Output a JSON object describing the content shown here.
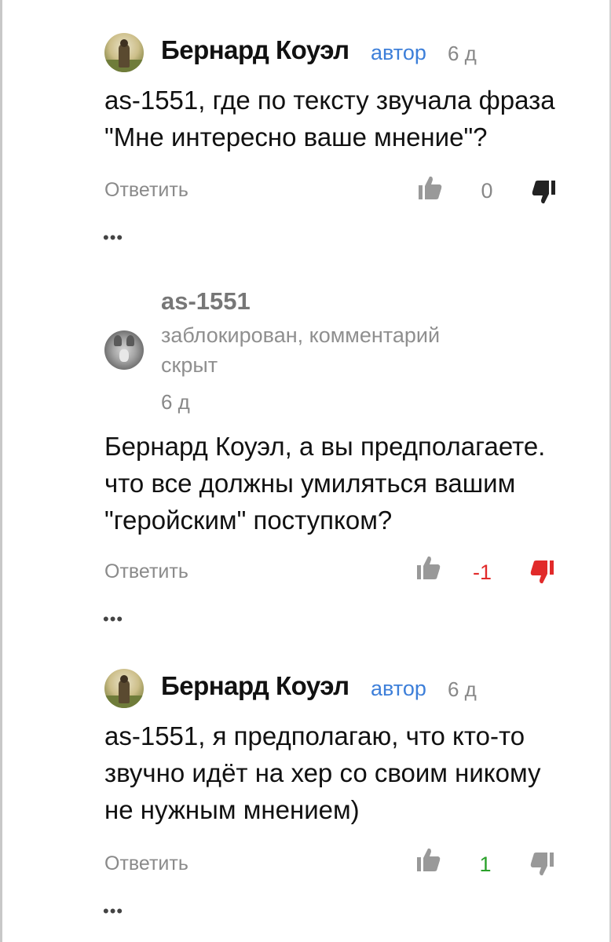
{
  "comments": [
    {
      "author": "Бернард Коуэл",
      "tag": "автор",
      "time": "6 д",
      "text_lines": [
        "as-1551, где по тексту звучала фраза",
        "\"Мне интересно ваше мнение\"?"
      ],
      "reply_label": "Ответить",
      "score": "0",
      "more": "•••"
    },
    {
      "author": "as-1551",
      "status_lines": [
        "заблокирован, комментарий",
        "скрыт"
      ],
      "time": "6 д",
      "text_lines": [
        "Бернард Коуэл, а вы предполагаете.",
        "что все должны умиляться вашим",
        "\"геройским\" поступком?"
      ],
      "reply_label": "Ответить",
      "score": "-1",
      "more": "•••"
    },
    {
      "author": "Бернард Коуэл",
      "tag": "автор",
      "time": "6 д",
      "text_lines": [
        "as-1551, я предполагаю, что кто-то",
        "звучно идёт на хер со своим никому",
        "не нужным мнением)"
      ],
      "reply_label": "Ответить",
      "score": "1",
      "more": "•••"
    }
  ],
  "icons": {
    "like": "thumbs-up-icon",
    "dislike": "thumbs-down-icon",
    "more": "more-dots-icon"
  },
  "colors": {
    "link": "#3d7fd9",
    "negative": "#e12a2a",
    "positive": "#2aa12a",
    "muted": "#8a8a8a"
  }
}
